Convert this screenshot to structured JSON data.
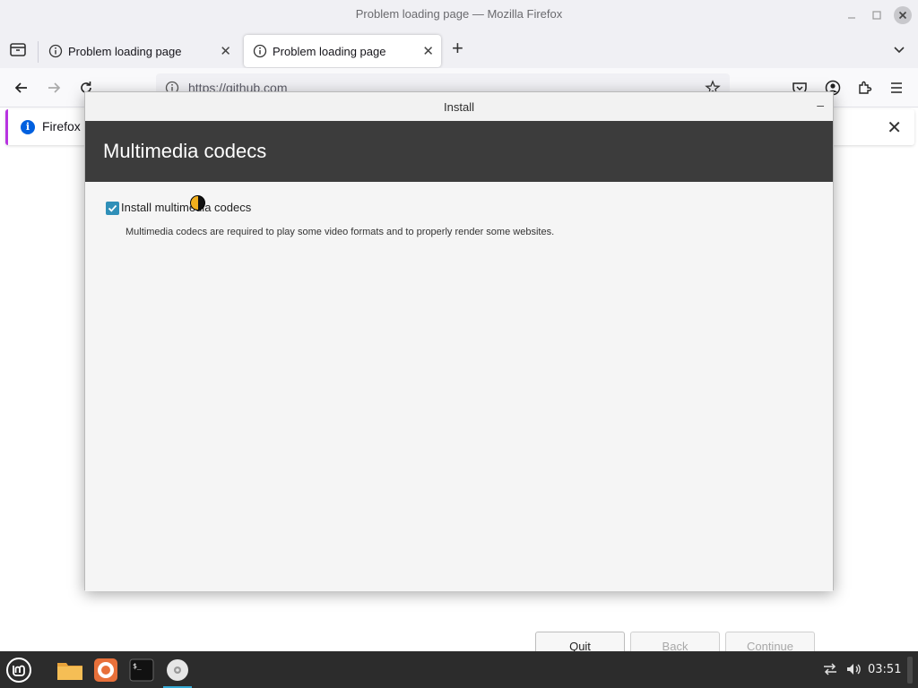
{
  "firefox": {
    "window_title": "Problem loading page — Mozilla Firefox",
    "tabs": [
      {
        "label": "Problem loading page",
        "close": "✕"
      },
      {
        "label": "Problem loading page",
        "close": "✕"
      }
    ],
    "new_tab_glyph": "+",
    "url": "https://github.com",
    "notification": {
      "text": "Firefox a",
      "close": "✕",
      "info_glyph": "i"
    }
  },
  "dialog": {
    "title": "Install",
    "minimize_glyph": "–",
    "heading": "Multimedia codecs",
    "checkbox_label": "Install multimedia codecs",
    "checkbox_checked": true,
    "description": "Multimedia codecs are required to play some video formats and to properly render some websites.",
    "buttons": {
      "quit": "Quit",
      "back": "Back",
      "continue": "Continue"
    }
  },
  "taskbar": {
    "clock": "03:51",
    "apps": [
      "files-icon",
      "firefox-icon",
      "terminal-icon",
      "installer-disc-icon"
    ]
  },
  "colors": {
    "dialog_header": "#3c3c3c",
    "checkbox": "#2f8fb8",
    "taskbar": "#2c2c2c",
    "active_indicator": "#35a9d4"
  }
}
